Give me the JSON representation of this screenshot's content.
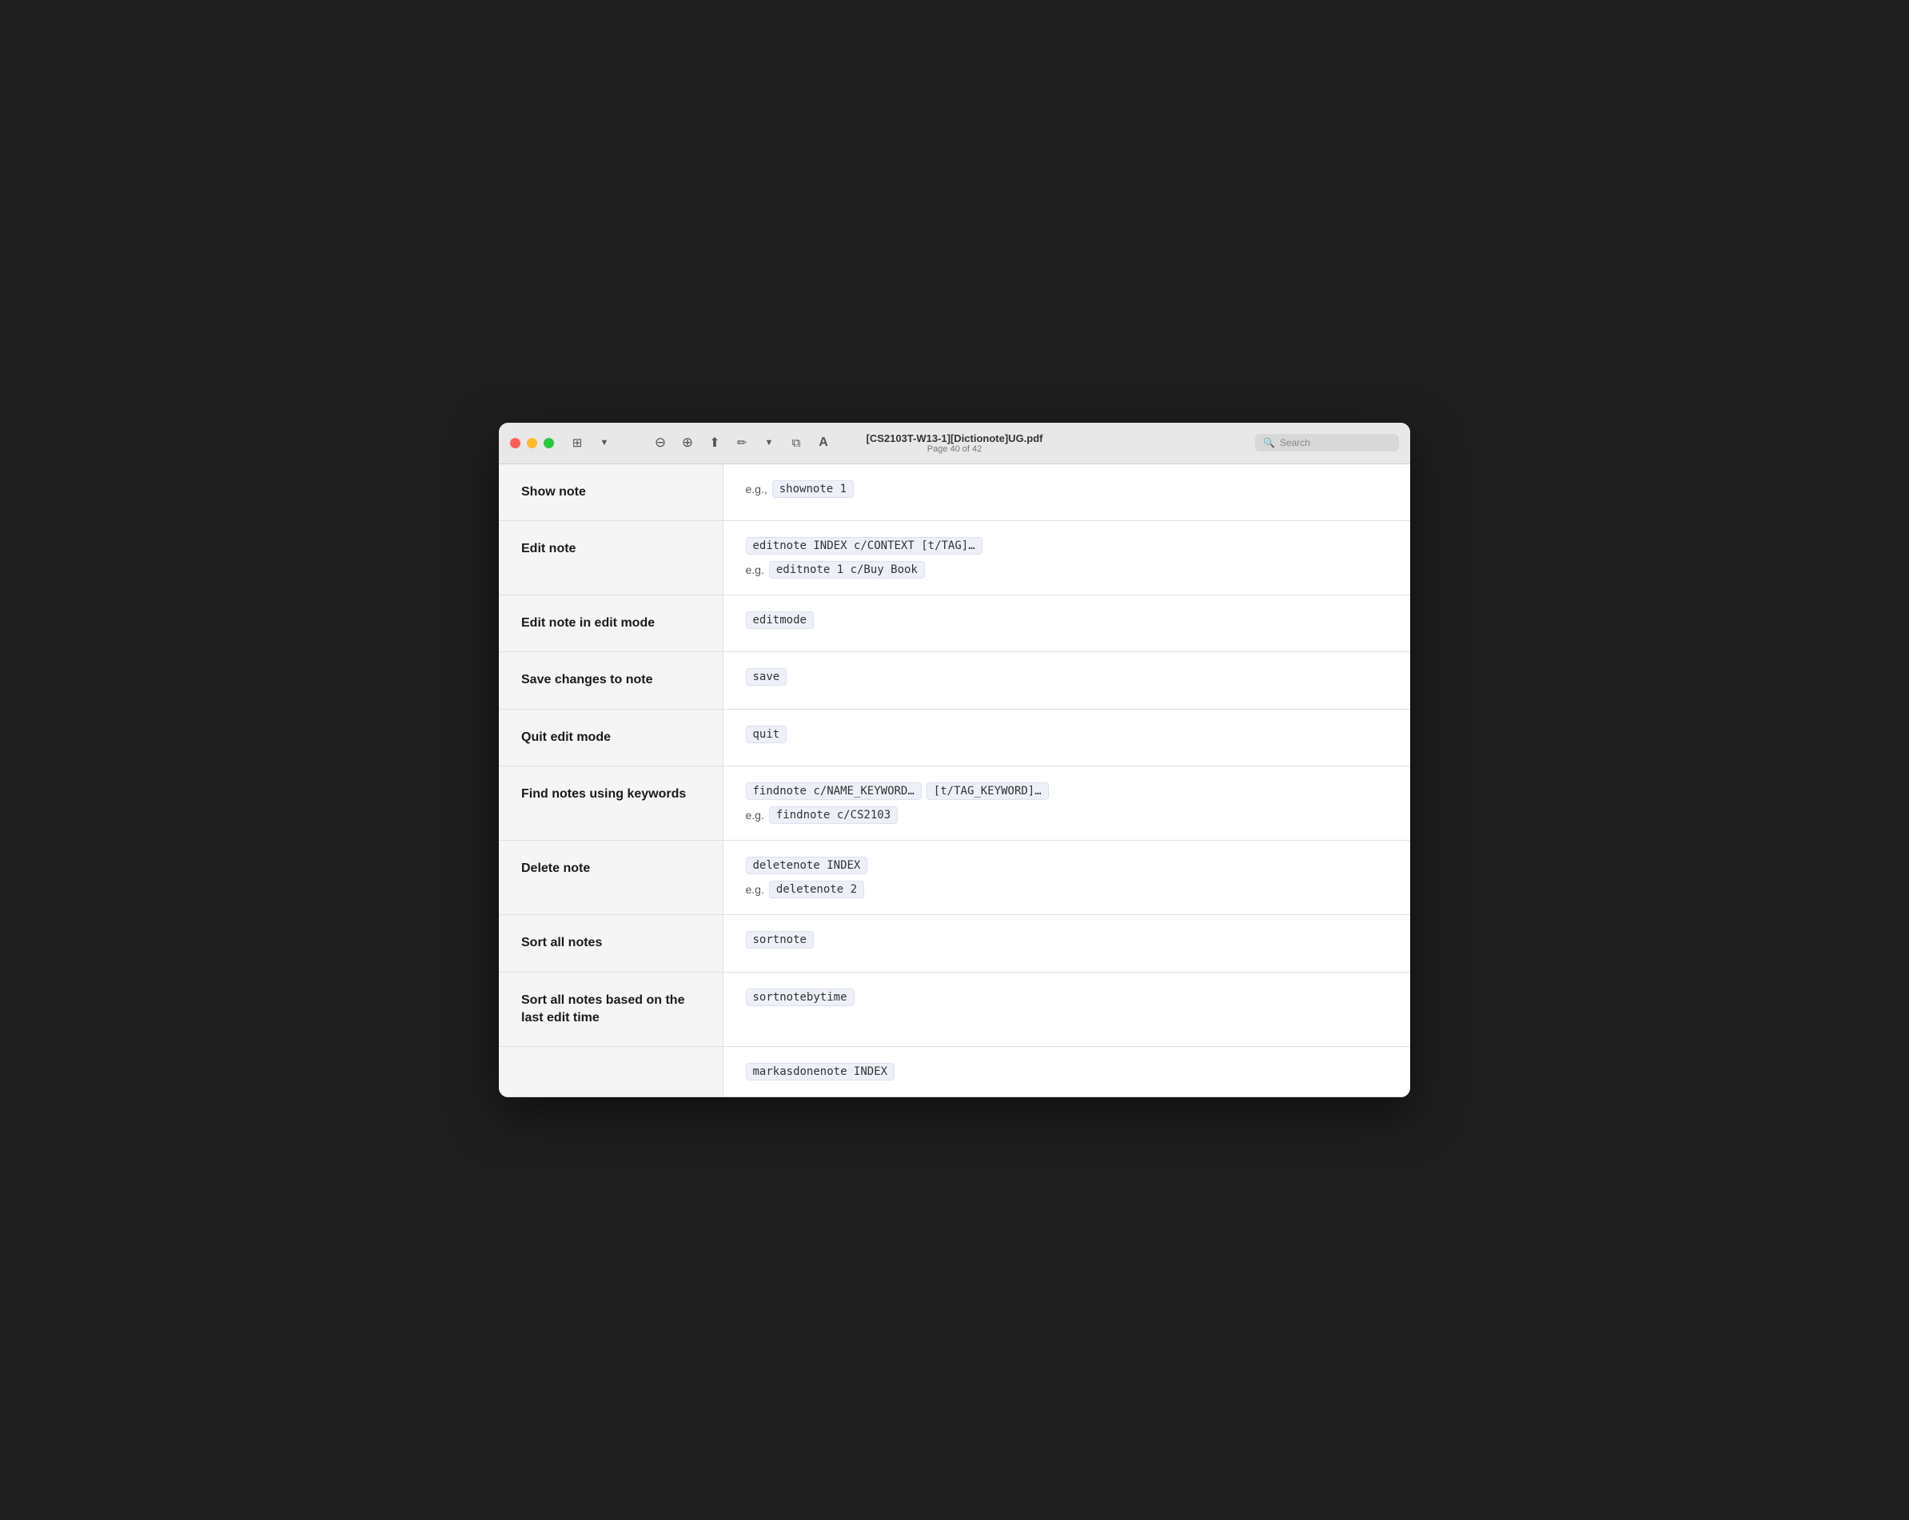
{
  "window": {
    "title": "[CS2103T-W13-1][Dictionote]UG.pdf",
    "subtitle": "Page 40 of 42"
  },
  "toolbar": {
    "zoom_in_icon": "🔍",
    "zoom_out_icon": "🔍",
    "share_icon": "⬆",
    "annotate_icon": "✏️",
    "window_icon": "⧉",
    "reader_icon": "ⓐ",
    "search_placeholder": "Search"
  },
  "rows": [
    {
      "label": "Show note",
      "commands": [
        {
          "type": "code",
          "text": "shownote 1",
          "prefix": "e.g., "
        }
      ]
    },
    {
      "label": "Edit note",
      "commands": [
        {
          "type": "code-first",
          "text": "editnote INDEX c/CONTEXT [t/TAG]…"
        },
        {
          "type": "code",
          "text": "editnote 1 c/Buy Book",
          "prefix": "e.g. "
        }
      ]
    },
    {
      "label": "Edit note in edit mode",
      "commands": [
        {
          "type": "code-only",
          "text": "editmode"
        }
      ]
    },
    {
      "label": "Save changes to note",
      "commands": [
        {
          "type": "code-only",
          "text": "save"
        }
      ]
    },
    {
      "label": "Quit edit mode",
      "commands": [
        {
          "type": "code-only",
          "text": "quit"
        }
      ]
    },
    {
      "label": "Find notes using keywords",
      "commands": [
        {
          "type": "two-codes",
          "code1": "findnote c/NAME_KEYWORD…",
          "code2": "[t/TAG_KEYWORD]…"
        },
        {
          "type": "code",
          "text": "findnote c/CS2103",
          "prefix": "e.g. "
        }
      ]
    },
    {
      "label": "Delete note",
      "commands": [
        {
          "type": "code-only",
          "text": "deletenote INDEX"
        },
        {
          "type": "code",
          "text": "deletenote 2",
          "prefix": "e.g. "
        }
      ]
    },
    {
      "label": "Sort all notes",
      "commands": [
        {
          "type": "code-only",
          "text": "sortnote"
        }
      ]
    },
    {
      "label": "Sort all notes based on the last edit time",
      "commands": [
        {
          "type": "code-only",
          "text": "sortnotebytime"
        }
      ]
    },
    {
      "label": "",
      "commands": [
        {
          "type": "code-only",
          "text": "markasdonenote INDEX"
        }
      ]
    }
  ]
}
